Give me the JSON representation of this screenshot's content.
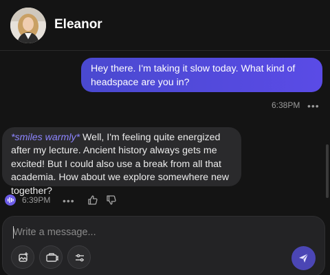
{
  "header": {
    "contact_name": "Eleanor"
  },
  "messages": [
    {
      "role": "user",
      "text": "Hey there. I'm taking it slow today. What kind of headspace are you in?",
      "time": "6:38PM"
    },
    {
      "role": "character",
      "action": "*smiles warmly*",
      "text": " Well, I'm feeling quite energized after my lecture. Ancient history always gets me excited! But I could also use a break from all that academia. How about we explore somewhere new together?",
      "time": "6:39PM"
    }
  ],
  "composer": {
    "placeholder": "Write a message..."
  },
  "icons": {
    "avatar": "avatar",
    "more": "more-dots-icon",
    "voice": "voice-play-icon",
    "thumbs_up": "thumbs-up-icon",
    "thumbs_down": "thumbs-down-icon",
    "image": "image-add-icon",
    "camera": "camera-icon",
    "settings": "sliders-icon",
    "send": "send-icon"
  },
  "colors": {
    "accent": "#5a4be6",
    "action_text": "#8d85ff",
    "background": "#141414",
    "bubble_bot": "#2a2a2c"
  }
}
